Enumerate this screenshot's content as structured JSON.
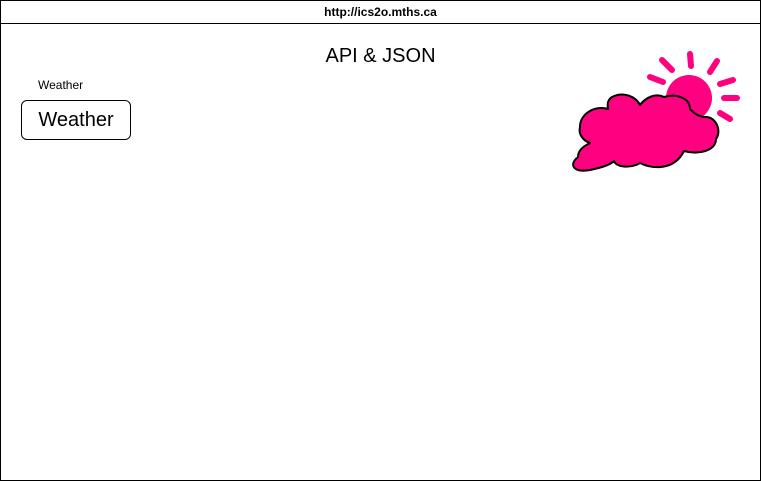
{
  "browser": {
    "url": "http://ics2o.mths.ca"
  },
  "page": {
    "title": "API & JSON"
  },
  "weather": {
    "label": "Weather",
    "button_label": "Weather",
    "icon": "sun-behind-cloud-icon",
    "icon_color": "#ff0080"
  }
}
